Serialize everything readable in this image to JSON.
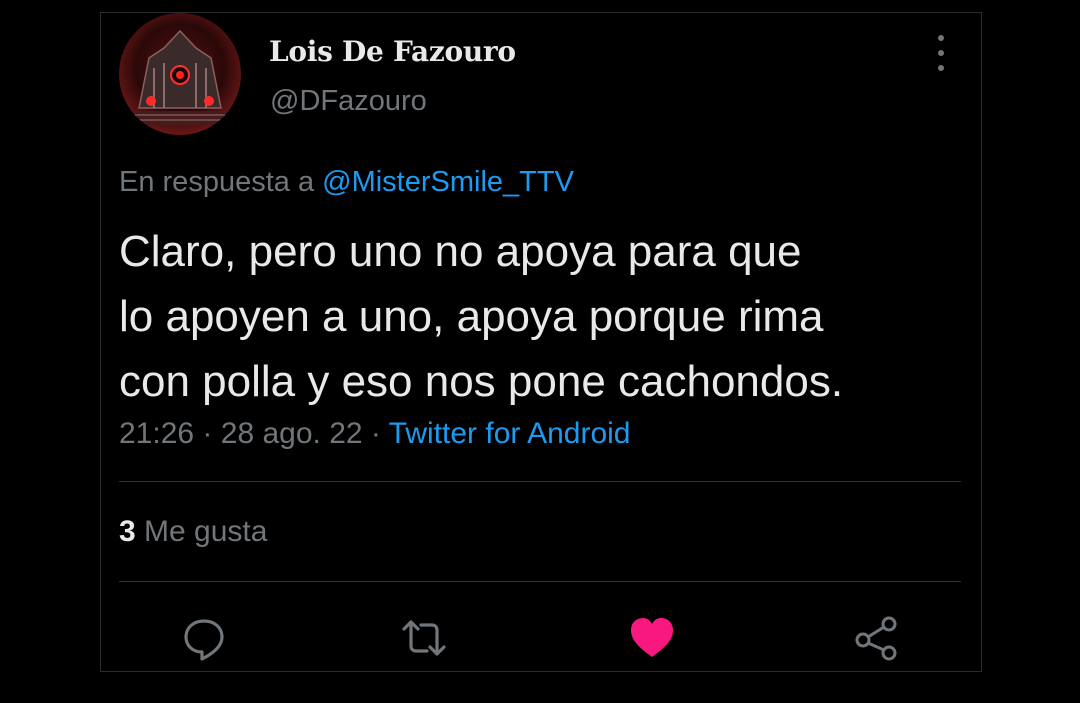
{
  "author": {
    "name": "Lois De Fazouro",
    "handle": "@DFazouro"
  },
  "reply": {
    "prefix": "En respuesta a",
    "mention": "@MisterSmile_TTV"
  },
  "tweet": {
    "line1": "Claro, pero uno no apoya para que",
    "line2": "lo apoyen a uno, apoya porque rima",
    "line3": "con polla y eso nos pone cachondos."
  },
  "meta": {
    "time": "21:26",
    "sep1": "·",
    "date": "28 ago. 22",
    "sep2": "·",
    "source": "Twitter for Android"
  },
  "engagement": {
    "likes_count": "3",
    "likes_label": "Me gusta"
  },
  "actions": {
    "reply_icon": "speech-bubble",
    "retweet_icon": "retweet-arrows",
    "like_icon": "heart-filled",
    "share_icon": "share-nodes"
  },
  "colors": {
    "background": "#000000",
    "text": "#e7e9ea",
    "secondary": "#71767b",
    "link": "#1d9bf0",
    "like": "#f91880"
  }
}
